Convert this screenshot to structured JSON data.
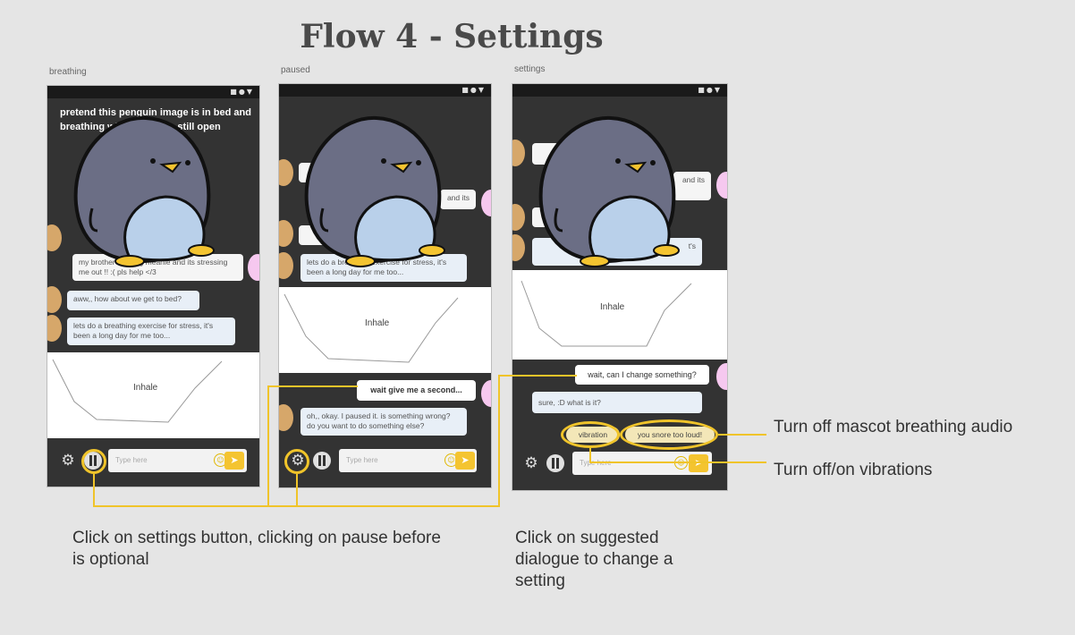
{
  "title": "Flow 4 - Settings",
  "screens": [
    {
      "label": "breathing",
      "note": "pretend this penguin image is in bed and breathing with you, eyes still open",
      "bubbles": {
        "user1": "my brother is being meanie and its stressing me out !! :( pls help </3",
        "bot1": "aww,, how about we get to bed?",
        "bot2": "lets do a breathing exercise for stress, it's been a long day for me too..."
      },
      "breath_label": "Inhale",
      "input_placeholder": "Type here"
    },
    {
      "label": "paused",
      "bubbles": {
        "partial_top": "and its",
        "bot2": "lets do a breathing exercise for stress, it's been a long day for me too...",
        "user_wait": "wait give me a second...",
        "bot_paused": "oh,, okay. I paused it. is something wrong? do you want to do something else?"
      },
      "breath_label": "Inhale",
      "input_placeholder": "Type here"
    },
    {
      "label": "settings",
      "bubbles": {
        "partial_a": "and its",
        "partial_b": "t's",
        "user_change": "wait, can I change something?",
        "bot_what": "sure, :D what is it?"
      },
      "chips": [
        "vibration",
        "you snore too loud!"
      ],
      "breath_label": "Inhale",
      "input_placeholder": "Type here"
    }
  ],
  "annotations": {
    "settings_button": "Click on settings button, clicking on pause before is optional",
    "suggested_dialogue": "Click on suggested dialogue to change a setting",
    "audio": "Turn off mascot breathing audio",
    "vibrations": "Turn off/on vibrations"
  },
  "colors": {
    "highlight": "#f0c42a",
    "phone_bg": "#333333",
    "penguin_body": "#6b6e85",
    "penguin_belly": "#b9d0ea",
    "beak": "#f4c430"
  }
}
